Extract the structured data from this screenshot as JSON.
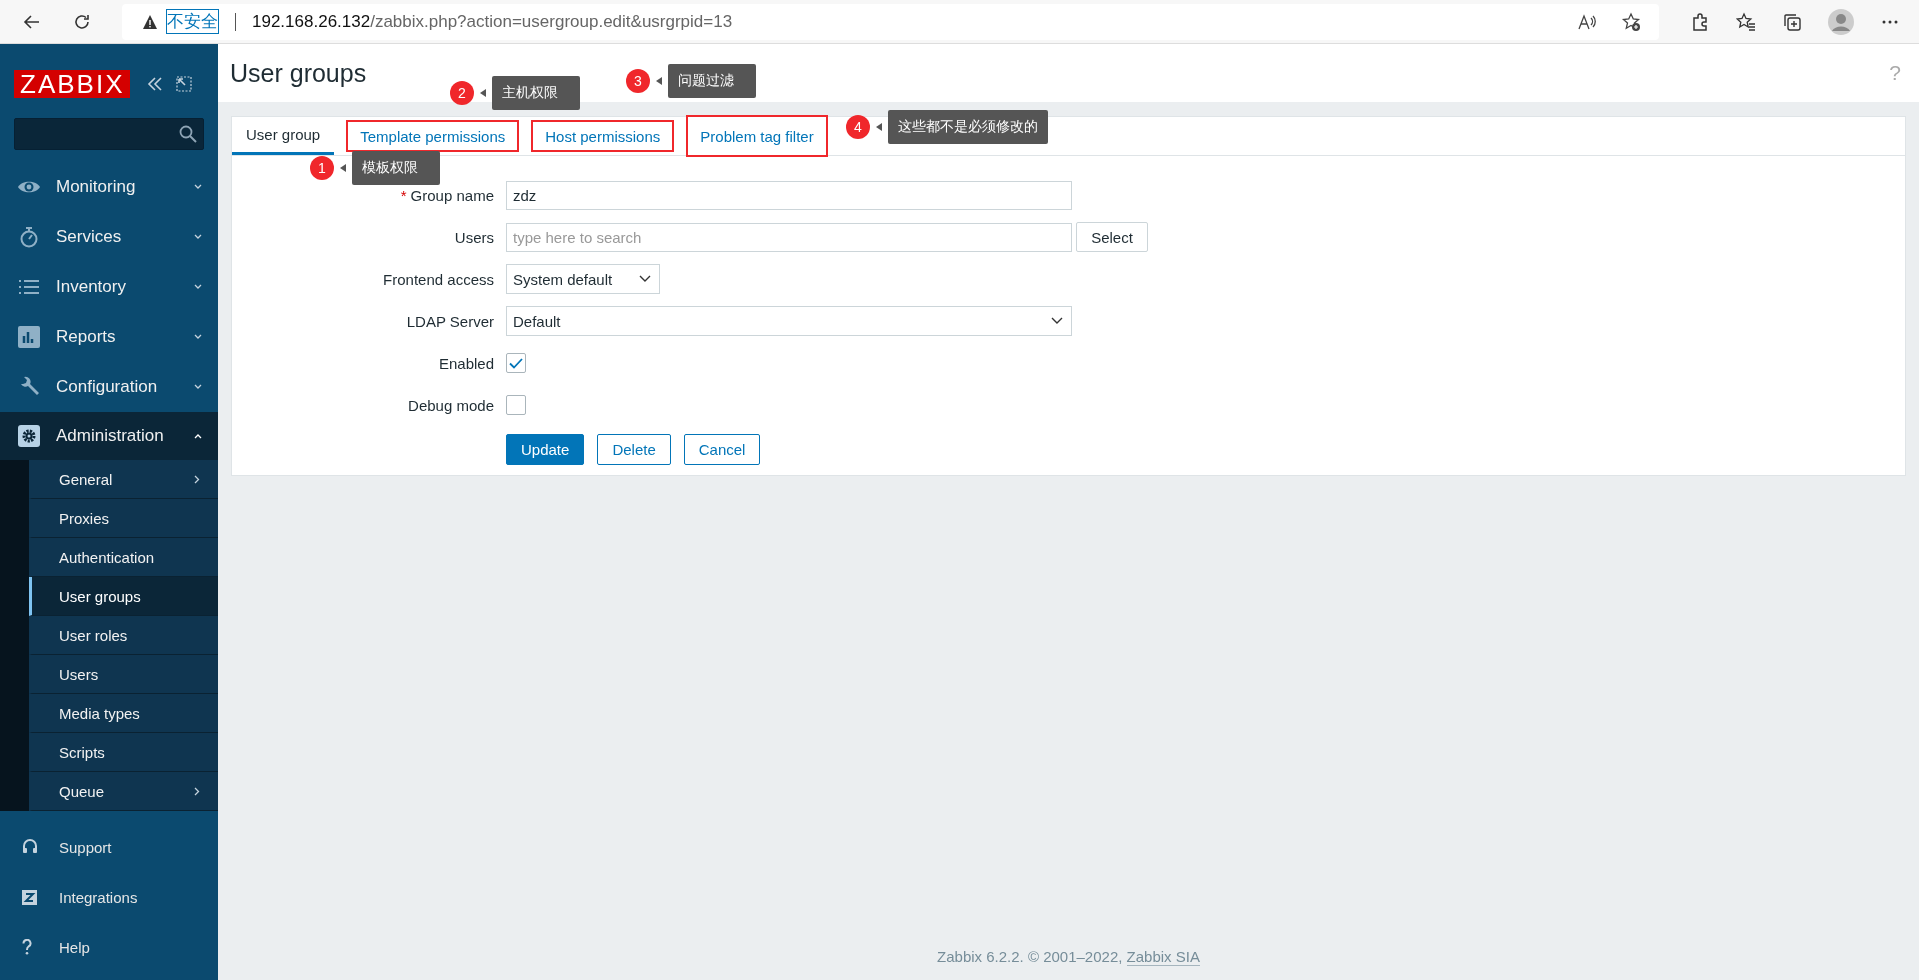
{
  "browser": {
    "security": "不安全",
    "url_host": "192.168.26.132",
    "url_path": "/zabbix.php?action=usergroup.edit&usrgrpid=13"
  },
  "sidebar": {
    "logo": "ZABBIX",
    "menu": [
      {
        "label": "Monitoring",
        "kind": "eye",
        "expanded": false
      },
      {
        "label": "Services",
        "kind": "timer",
        "expanded": false
      },
      {
        "label": "Inventory",
        "kind": "list",
        "expanded": false
      },
      {
        "label": "Reports",
        "kind": "chart",
        "expanded": false
      },
      {
        "label": "Configuration",
        "kind": "wrench",
        "expanded": false
      },
      {
        "label": "Administration",
        "kind": "gear",
        "expanded": true,
        "children": [
          {
            "label": "General",
            "selected": false,
            "submenu": true
          },
          {
            "label": "Proxies",
            "selected": false,
            "submenu": false
          },
          {
            "label": "Authentication",
            "selected": false,
            "submenu": false
          },
          {
            "label": "User groups",
            "selected": true,
            "submenu": false
          },
          {
            "label": "User roles",
            "selected": false,
            "submenu": false
          },
          {
            "label": "Users",
            "selected": false,
            "submenu": false
          },
          {
            "label": "Media types",
            "selected": false,
            "submenu": false
          },
          {
            "label": "Scripts",
            "selected": false,
            "submenu": false
          },
          {
            "label": "Queue",
            "selected": false,
            "submenu": true
          }
        ]
      }
    ],
    "footer_items": [
      {
        "label": "Support",
        "kind": "headset"
      },
      {
        "label": "Integrations",
        "kind": "z"
      },
      {
        "label": "Help",
        "kind": "help"
      }
    ]
  },
  "page": {
    "title": "User groups",
    "help": "?"
  },
  "tabs": [
    {
      "label": "User group",
      "selected": true,
      "highlighted": false
    },
    {
      "label": "Template permissions",
      "selected": false,
      "highlighted": true
    },
    {
      "label": "Host permissions",
      "selected": false,
      "highlighted": true
    },
    {
      "label": "Problem tag filter",
      "selected": false,
      "highlighted": true
    }
  ],
  "form": [
    {
      "label": "Group name",
      "kind": "text",
      "required_mark": "*",
      "value": "zdz"
    },
    {
      "label": "Users",
      "kind": "search",
      "placeholder": "type here to search",
      "button": "Select"
    },
    {
      "label": "Frontend access",
      "kind": "select-short",
      "value": "System default"
    },
    {
      "label": "LDAP Server",
      "kind": "select",
      "value": "Default"
    },
    {
      "label": "Enabled",
      "kind": "checkbox",
      "checked": true
    },
    {
      "label": "Debug mode",
      "kind": "checkbox",
      "checked": false
    }
  ],
  "buttons": [
    {
      "label": "Update",
      "kind": "primary"
    },
    {
      "label": "Delete",
      "kind": "secondary"
    },
    {
      "label": "Cancel",
      "kind": "secondary"
    }
  ],
  "annotations": [
    {
      "number": "1",
      "text": "模板权限"
    },
    {
      "number": "2",
      "text": "主机权限"
    },
    {
      "number": "3",
      "text": "问题过滤"
    },
    {
      "number": "4",
      "text": "这些都不是必须修改的"
    }
  ],
  "footer": {
    "text": "Zabbix 6.2.2. © 2001–2022, ",
    "link": "Zabbix SIA"
  }
}
